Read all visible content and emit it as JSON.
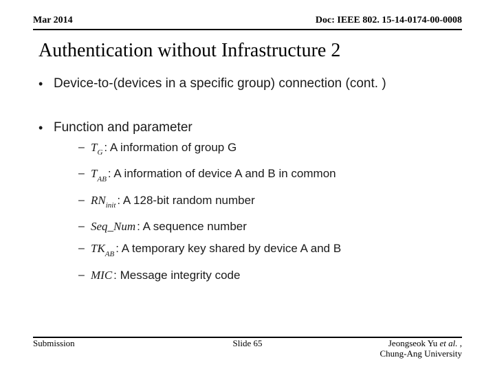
{
  "header": {
    "date": "Mar 2014",
    "doc": "Doc: IEEE 802. 15-14-0174-00-0008"
  },
  "title": "Authentication without Infrastructure 2",
  "bullets": {
    "b0": "Device-to-(devices in a specific group) connection (cont. )",
    "b1": "Function and parameter"
  },
  "params": {
    "p0": {
      "sym": "T",
      "sub": "G",
      "desc": ": A information of group G"
    },
    "p1": {
      "sym": "T",
      "sub": "AB",
      "desc": ": A information of device A and B in common"
    },
    "p2": {
      "sym": "RN",
      "sub": "init",
      "desc": ": A 128-bit random number"
    },
    "p3": {
      "sym": "Seq_Num",
      "sub": "",
      "desc": ": A sequence number"
    },
    "p4": {
      "sym": "TK",
      "sub": "AB",
      "desc": ": A temporary key shared  by device A and B"
    },
    "p5": {
      "sym": "MIC",
      "sub": "",
      "desc": ": Message integrity code"
    }
  },
  "footer": {
    "left": "Submission",
    "center": "Slide 65",
    "author_line1_pre": "Jeongseok Yu ",
    "author_line1_etal": "et al.",
    "author_line1_post": " ,",
    "author_line2": "Chung-Ang University"
  }
}
